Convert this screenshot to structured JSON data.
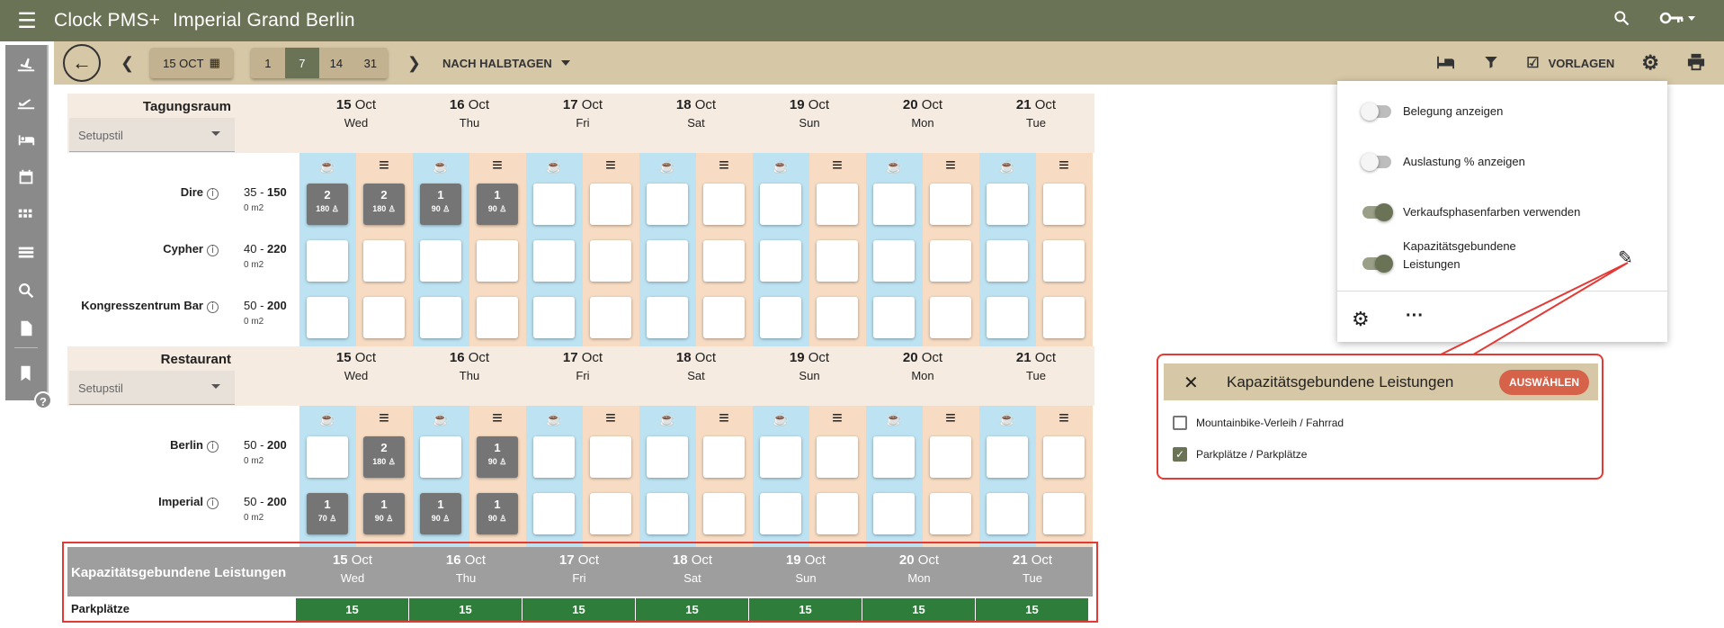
{
  "app": {
    "name": "Clock PMS+",
    "hotel": "Imperial Grand Berlin"
  },
  "toolbar": {
    "date": "15 OCT",
    "ranges": [
      "1",
      "7",
      "14",
      "31"
    ],
    "active_range": "7",
    "mode": "NACH HALBTAGEN",
    "vorlagen": "VORLAGEN"
  },
  "days": [
    {
      "num": "15",
      "mon": "Oct",
      "wd": "Wed"
    },
    {
      "num": "16",
      "mon": "Oct",
      "wd": "Thu"
    },
    {
      "num": "17",
      "mon": "Oct",
      "wd": "Fri"
    },
    {
      "num": "18",
      "mon": "Oct",
      "wd": "Sat"
    },
    {
      "num": "19",
      "mon": "Oct",
      "wd": "Sun"
    },
    {
      "num": "20",
      "mon": "Oct",
      "wd": "Mon"
    },
    {
      "num": "21",
      "mon": "Oct",
      "wd": "Tue"
    }
  ],
  "groups": [
    {
      "title": "Tagungsraum",
      "setup": "Setupstil",
      "rooms": [
        {
          "name": "Dire",
          "cap_min": "35",
          "cap_max": "150",
          "area": "0 m2",
          "cells": [
            [
              "2",
              "180"
            ],
            [
              "2",
              "180"
            ],
            [
              "1",
              "90"
            ],
            [
              "1",
              "90"
            ],
            null,
            null,
            null,
            null,
            null,
            null,
            null,
            null,
            null,
            null
          ]
        },
        {
          "name": "Cypher",
          "cap_min": "40",
          "cap_max": "220",
          "area": "0 m2",
          "cells": [
            null,
            null,
            null,
            null,
            null,
            null,
            null,
            null,
            null,
            null,
            null,
            null,
            null,
            null
          ]
        },
        {
          "name": "Kongresszentrum Bar",
          "cap_min": "50",
          "cap_max": "200",
          "area": "0 m2",
          "cells": [
            null,
            null,
            null,
            null,
            null,
            null,
            null,
            null,
            null,
            null,
            null,
            null,
            null,
            null
          ]
        }
      ]
    },
    {
      "title": "Restaurant",
      "setup": "Setupstil",
      "rooms": [
        {
          "name": "Berlin",
          "cap_min": "50",
          "cap_max": "200",
          "area": "0 m2",
          "cells": [
            null,
            [
              "2",
              "180"
            ],
            null,
            [
              "1",
              "90"
            ],
            null,
            null,
            null,
            null,
            null,
            null,
            null,
            null,
            null,
            null
          ]
        },
        {
          "name": "Imperial",
          "cap_min": "50",
          "cap_max": "200",
          "area": "0 m2",
          "cells": [
            [
              "1",
              "70"
            ],
            [
              "1",
              "90"
            ],
            [
              "1",
              "90"
            ],
            [
              "1",
              "90"
            ],
            null,
            null,
            null,
            null,
            null,
            null,
            null,
            null,
            null,
            null
          ]
        }
      ]
    }
  ],
  "kapazitaet": {
    "title": "Kapazitätsgebundene Leistungen",
    "row_label": "Parkplätze",
    "values": [
      "15",
      "15",
      "15",
      "15",
      "15",
      "15",
      "15"
    ]
  },
  "popup": {
    "items": [
      {
        "label": "Belegung anzeigen",
        "on": false
      },
      {
        "label": "Auslastung % anzeigen",
        "on": false
      },
      {
        "label": "Verkaufsphasenfarben verwenden",
        "on": true
      },
      {
        "label1": "Kapazitätsgebundene",
        "label2": "Leistungen",
        "on": true
      }
    ]
  },
  "dialog": {
    "title": "Kapazitätsgebundene Leistungen",
    "button": "AUSWÄHLEN",
    "options": [
      {
        "label": "Mountainbike-Verleih / Fahrrad",
        "checked": false
      },
      {
        "label": "Parkplätze / Parkplätze",
        "checked": true
      }
    ]
  },
  "help": "?"
}
